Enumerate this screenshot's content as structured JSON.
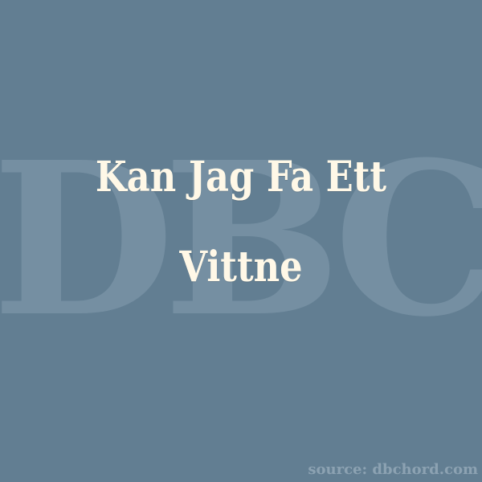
{
  "background_color": "#627e92",
  "watermark": {
    "text": "DBC",
    "color": "#7b95a7"
  },
  "title": {
    "line1": "Kan Jag Fa Ett",
    "line2": "Vittne",
    "color": "#fff8e7"
  },
  "source": {
    "text": "source: dbchord.com",
    "color": "#8ca2b2"
  }
}
